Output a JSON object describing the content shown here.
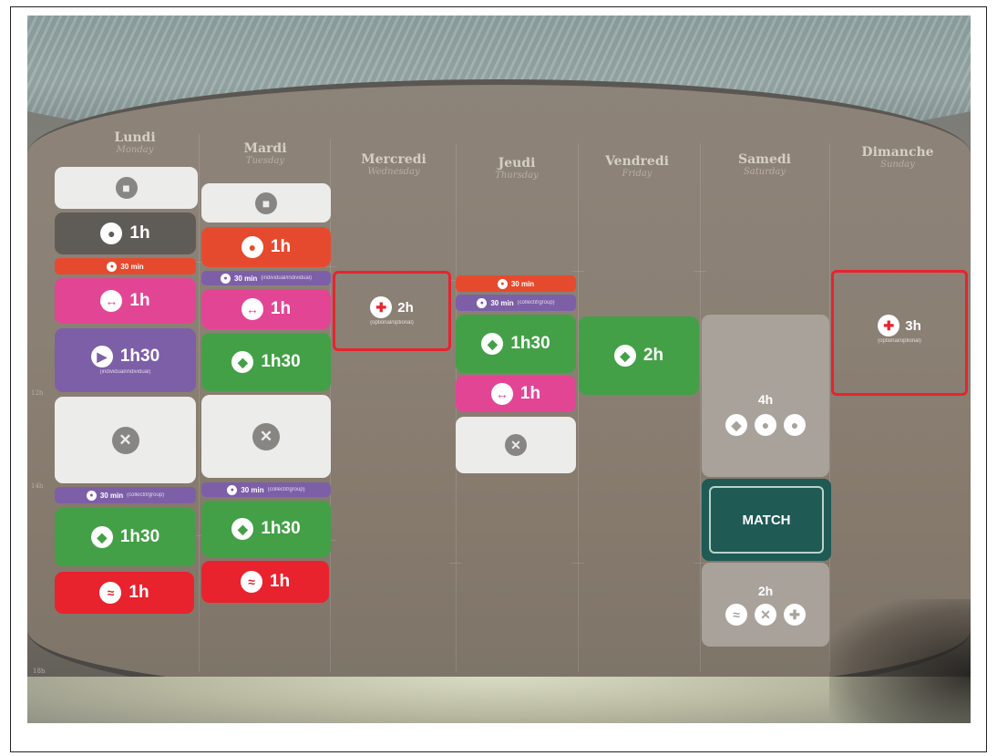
{
  "days": [
    {
      "fr": "Lundi",
      "en": "Monday"
    },
    {
      "fr": "Mardi",
      "en": "Tuesday"
    },
    {
      "fr": "Mercredi",
      "en": "Wednesday"
    },
    {
      "fr": "Jeudi",
      "en": "Thursday"
    },
    {
      "fr": "Vendredi",
      "en": "Friday"
    },
    {
      "fr": "Samedi",
      "en": "Saturday"
    },
    {
      "fr": "Dimanche",
      "en": "Sunday"
    }
  ],
  "hours": {
    "h12": "12h",
    "h14": "14h",
    "h18": "18h"
  },
  "blocks": {
    "mon": {
      "fitness": "1h",
      "run": "30 min",
      "weights": "1h",
      "video": "1h30",
      "video_sub": "(individual/individual)",
      "talk": "30 min",
      "talk_sub": "(collectif/group)",
      "rugby": "1h30",
      "swim": "1h"
    },
    "tue": {
      "run": "1h",
      "talk1": "30 min",
      "talk1_sub": "(individual/individual)",
      "weights": "1h",
      "rugby1": "1h30",
      "talk2": "30 min",
      "talk2_sub": "(collectif/group)",
      "rugby2": "1h30",
      "swim": "1h"
    },
    "wed": {
      "medical": "2h",
      "medical_sub": "(optional/optional)"
    },
    "thu": {
      "run": "30 min",
      "talk": "30 min",
      "talk_sub": "(collectif/group)",
      "rugby": "1h30",
      "weights": "1h"
    },
    "fri": {
      "rugby": "2h"
    },
    "sat": {
      "session1": "4h",
      "match": "MATCH",
      "session2": "2h"
    },
    "sun": {
      "medical": "3h",
      "medical_sub": "(optional/optional)"
    }
  },
  "icons": {
    "notebook": "notebook-icon",
    "team": "team-meeting-icon",
    "runner": "runner-icon",
    "dumbbell": "dumbbell-icon",
    "camera": "video-camera-icon",
    "chat": "chat-bubble-icon",
    "rugby": "rugby-ball-icon",
    "swimmer": "swimmer-icon",
    "cutlery": "cutlery-icon",
    "medical": "medical-cross-icon"
  },
  "colors": {
    "white": "#ececea",
    "gray": "#5f5c58",
    "orange": "#e64a2e",
    "pink": "#e34595",
    "purple": "#7d5fa8",
    "green": "#43a047",
    "red": "#e8232e",
    "match": "#1f5a55"
  }
}
